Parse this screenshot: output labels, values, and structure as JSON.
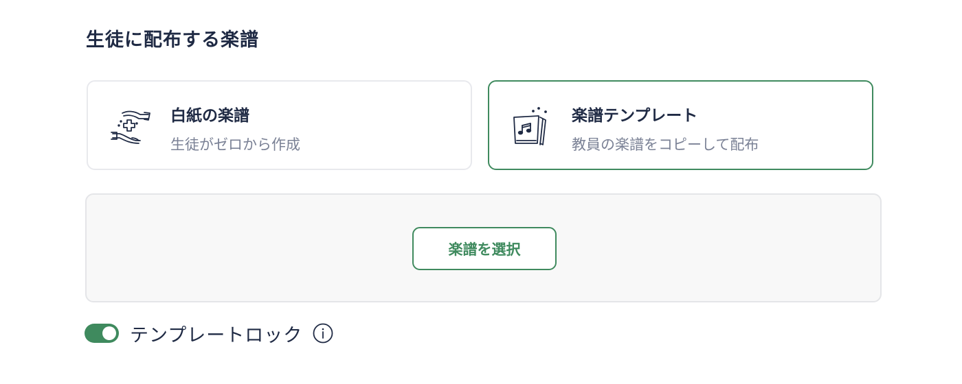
{
  "section": {
    "title": "生徒に配布する楽譜"
  },
  "options": {
    "blank": {
      "title": "白紙の楽譜",
      "description": "生徒がゼロから作成",
      "icon": "hands-plus-icon"
    },
    "template": {
      "title": "楽譜テンプレート",
      "description": "教員の楽譜をコピーして配布",
      "icon": "sheet-music-icon",
      "selected": true
    }
  },
  "picker": {
    "button_label": "楽譜を選択"
  },
  "template_lock": {
    "label": "テンプレートロック",
    "enabled": true,
    "info_icon": "info-icon"
  },
  "colors": {
    "accent": "#3f8a5e",
    "text_primary": "#1f2a44",
    "text_secondary": "#7a8195",
    "border": "#e8e9ed",
    "panel_bg": "#f8f8f8"
  }
}
